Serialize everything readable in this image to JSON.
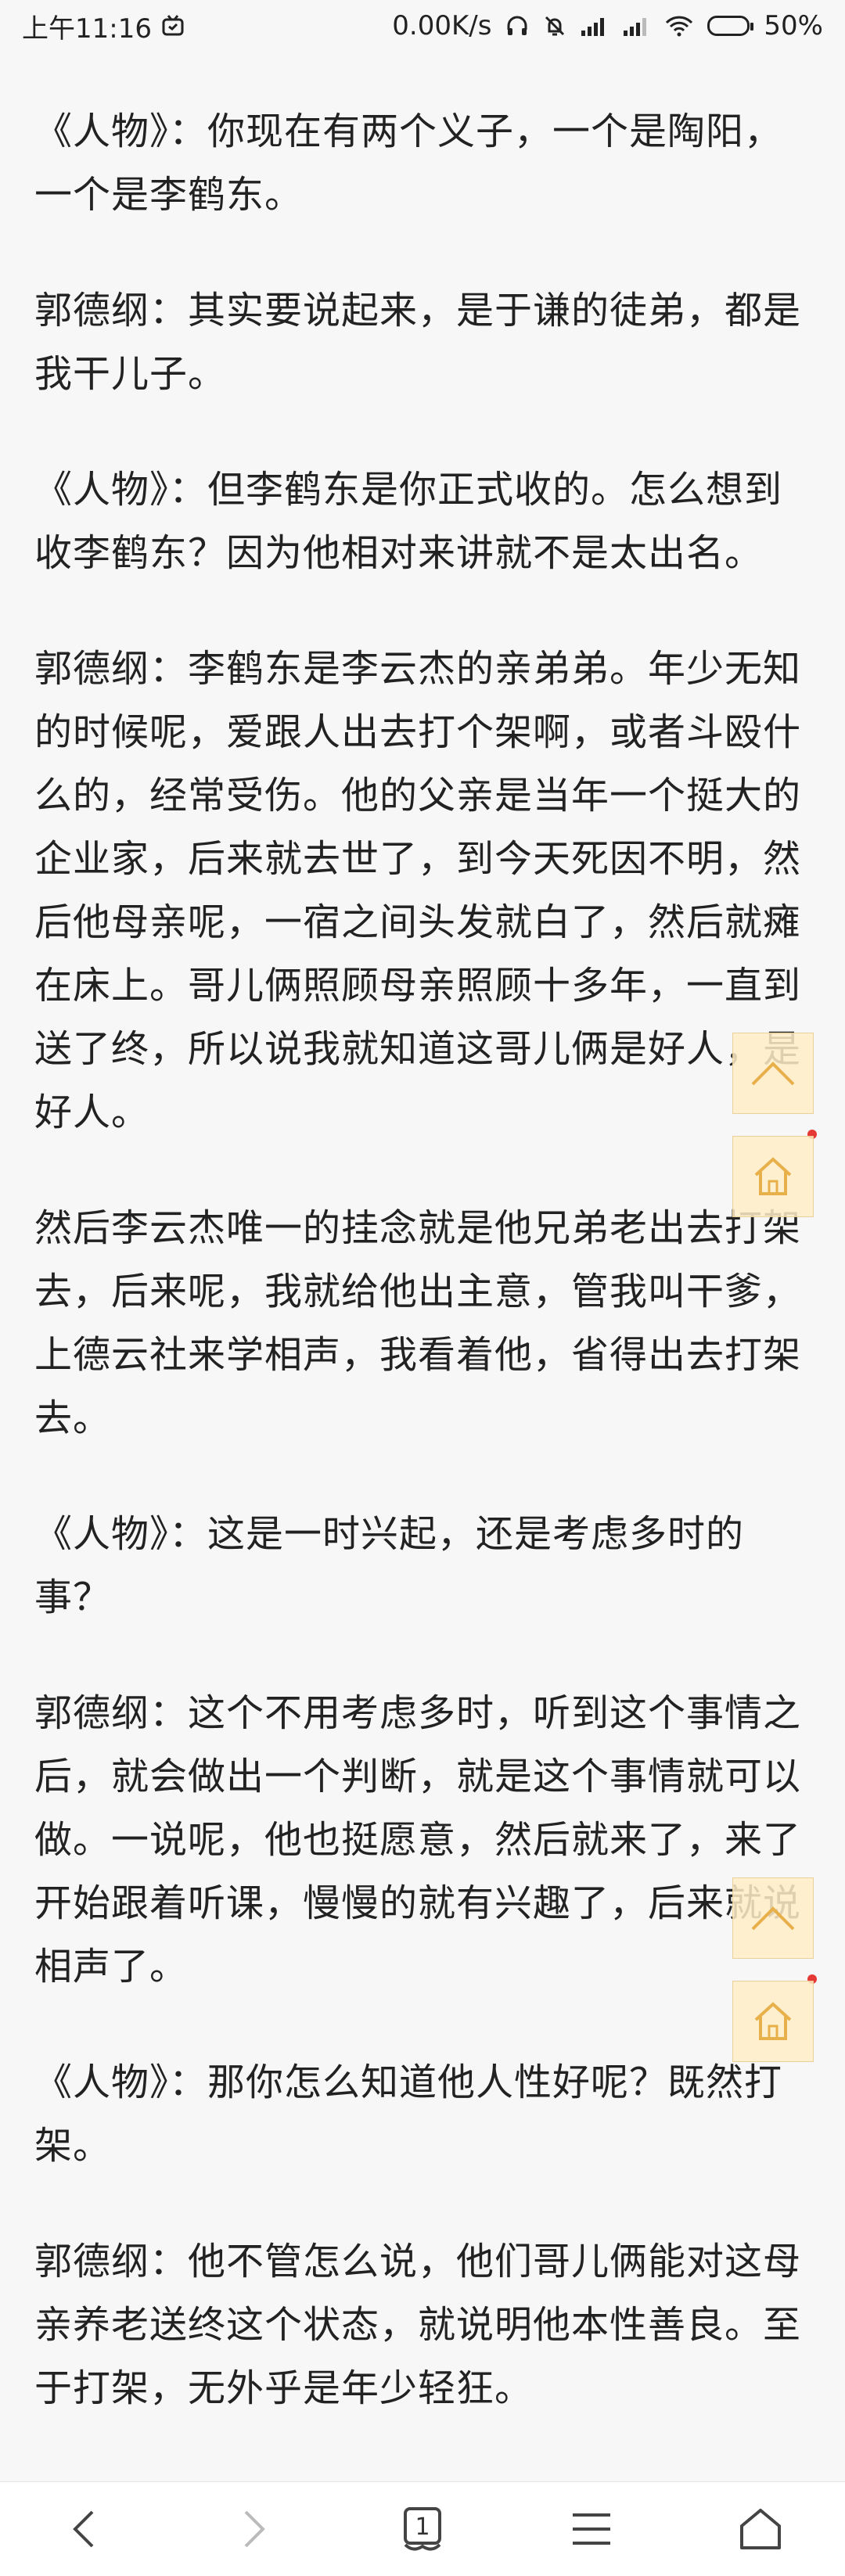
{
  "status_bar": {
    "time": "上午11:16",
    "net_speed": "0.00K/s",
    "battery": "50%",
    "battery_level": 0.5,
    "icons": [
      "notification-app-icon",
      "headphone-icon",
      "mute-bell-icon",
      "signal-icon",
      "signal-icon",
      "wifi-icon",
      "battery-icon"
    ]
  },
  "article": {
    "paragraphs": [
      "《人物》：你现在有两个义子，一个是陶阳，一个是李鹤东。",
      "郭德纲：其实要说起来，是于谦的徒弟，都是我干儿子。",
      "《人物》：但李鹤东是你正式收的。怎么想到收李鹤东？因为他相对来讲就不是太出名。",
      "郭德纲：李鹤东是李云杰的亲弟弟。年少无知的时候呢，爱跟人出去打个架啊，或者斗殴什么的，经常受伤。他的父亲是当年一个挺大的企业家，后来就去世了，到今天死因不明，然后他母亲呢，一宿之间头发就白了，然后就瘫在床上。哥儿俩照顾母亲照顾十多年，一直到送了终，所以说我就知道这哥儿俩是好人，是好人。",
      "然后李云杰唯一的挂念就是他兄弟老出去打架去，后来呢，我就给他出主意，管我叫干爹，上德云社来学相声，我看着他，省得出去打架去。",
      "《人物》：这是一时兴起，还是考虑多时的事？",
      "郭德纲：这个不用考虑多时，听到这个事情之后，就会做出一个判断，就是这个事情就可以做。一说呢，他也挺愿意，然后就来了，来了开始跟着听课，慢慢的就有兴趣了，后来就说相声了。",
      "《人物》：那你怎么知道他人性好呢？既然打架。",
      "郭德纲：他不管怎么说，他们哥儿俩能对这母亲养老送终这个状态，就说明他本性善良。至于打架，无外乎是年少轻狂。"
    ]
  },
  "float_buttons": {
    "top_icon": "chevron-up-icon",
    "home_icon": "home-icon",
    "accent_color": "#e8b04a",
    "dot_color": "#e53935"
  },
  "bottom_nav": {
    "tab_count": "1",
    "icons": [
      "back-arrow-icon",
      "forward-arrow-icon",
      "tabs-icon",
      "menu-icon",
      "home-icon"
    ]
  }
}
